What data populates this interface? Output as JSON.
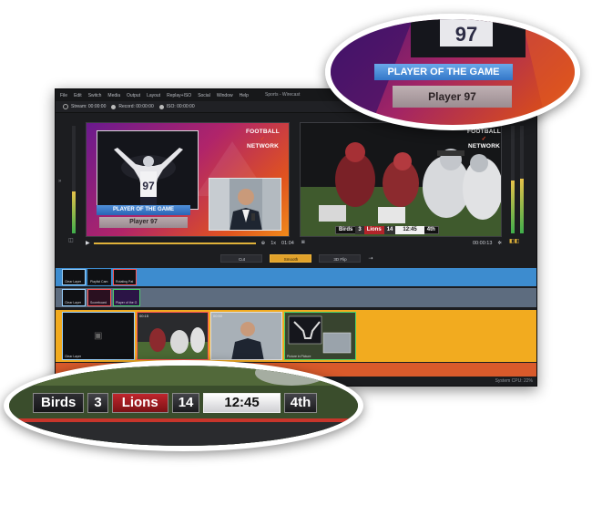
{
  "window": {
    "title": "Sports - Wirecast",
    "menu": [
      "File",
      "Edit",
      "Switch",
      "Media",
      "Output",
      "Layout",
      "Replay+ISO",
      "Social",
      "Window",
      "Help"
    ]
  },
  "status": {
    "stream_label": "Stream:",
    "stream_time": "00:00:00",
    "record_label": "Record:",
    "record_time": "00:00:00",
    "iso_label": "ISO:",
    "iso_time": "00:00:00"
  },
  "preview": {
    "network_line1": "FOOTBALL",
    "network_line2": "NETWORK",
    "player_jersey": "97",
    "title_bar": "PLAYER OF THE GAME",
    "name_bar": "Player 97",
    "speed": "1x",
    "time": "01:04"
  },
  "live": {
    "network_line1": "FOOTBALL",
    "network_line2": "NETWORK",
    "time": "00:00:13",
    "scoreboard": {
      "home_team": "Birds",
      "home_score": "3",
      "away_team": "Lions",
      "away_score": "14",
      "clock": "12:45",
      "quarter": "4th"
    }
  },
  "transitions": {
    "cut": "Cut",
    "smooth": "Smooth",
    "flip": "3D Flip"
  },
  "layers": {
    "layer1": [
      "Clear Layer",
      "Playlist Cam",
      "Rotating Pat"
    ],
    "layer2": [
      "Clear Layer",
      "Scoreboard",
      "Player of the G"
    ],
    "layer3": [
      {
        "label": "Clear Layer",
        "time": ""
      },
      {
        "label": "",
        "time": "00:15"
      },
      {
        "label": "",
        "time": "00:50"
      },
      {
        "label": "Picture in Picture",
        "time": ""
      }
    ]
  },
  "system": {
    "cpu_text": "System CPU: 22%"
  },
  "callout_top": {
    "title_bar": "PLAYER OF THE GAME",
    "name_bar": "Player 97",
    "jersey": "97"
  },
  "callout_bottom": {
    "home_team": "Birds",
    "home_score": "3",
    "away_team": "Lions",
    "away_score": "14",
    "clock": "12:45",
    "quarter": "4th"
  },
  "colors": {
    "accent_orange": "#f2ab1f",
    "bus_blue": "#3d8ccf",
    "bus_gray": "#5d6c7f",
    "bus_red": "#d95a2b",
    "lions_red": "#c0262d"
  }
}
